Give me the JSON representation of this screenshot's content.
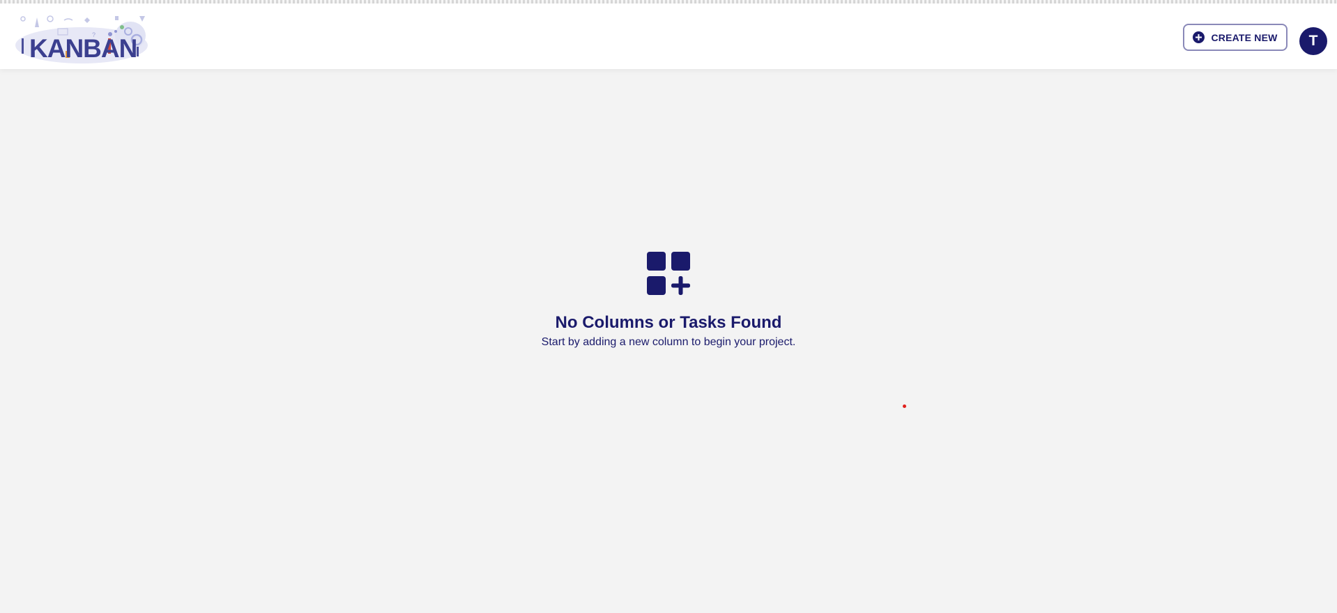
{
  "header": {
    "logo_text": "KANBAN",
    "create_button": {
      "label": "CREATE NEW",
      "icon": "plus-circle-icon"
    },
    "avatar_initial": "T"
  },
  "empty_state": {
    "icon": "add-grid-icon",
    "title": "No Columns or Tasks Found",
    "subtitle": "Start by adding a new column to begin your project."
  },
  "colors": {
    "primary": "#1a1a6b",
    "button_border": "#8a89b8",
    "background": "#f3f3f3",
    "header_bg": "#ffffff",
    "cursor_marker": "#e0201c"
  }
}
